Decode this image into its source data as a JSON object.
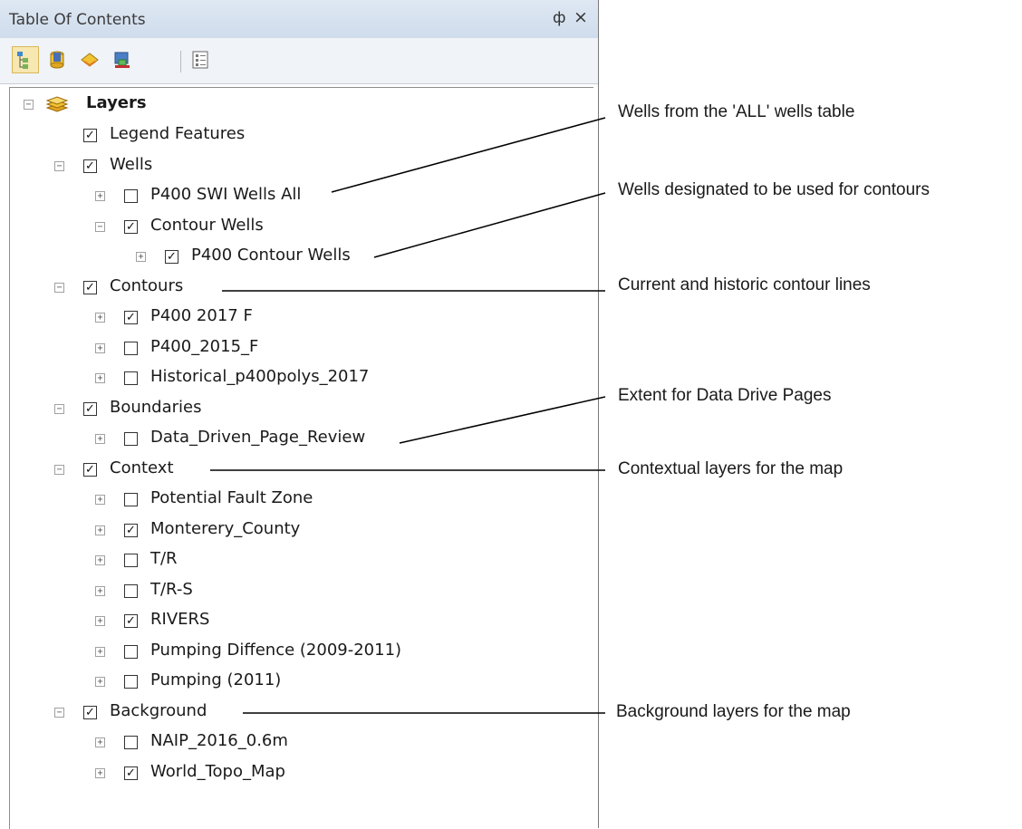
{
  "panel": {
    "title": "Table Of Contents",
    "pin_symbol": "ф",
    "close_symbol": "×",
    "toolbar": [
      {
        "name": "list-by-drawing-order-icon"
      },
      {
        "name": "list-by-source-icon"
      },
      {
        "name": "list-by-visibility-icon"
      },
      {
        "name": "list-by-selection-icon"
      },
      {
        "name": "options-icon"
      }
    ]
  },
  "tree": {
    "root": "Layers",
    "items": [
      {
        "label": "Legend Features",
        "checked": true,
        "expander": "",
        "indent": 0
      },
      {
        "label": "Wells",
        "checked": true,
        "expander": "minus",
        "indent": 0
      },
      {
        "label": "P400 SWI Wells All",
        "checked": false,
        "expander": "plus",
        "indent": 1
      },
      {
        "label": "Contour Wells",
        "checked": true,
        "expander": "minus",
        "indent": 1
      },
      {
        "label": "P400 Contour Wells",
        "checked": true,
        "expander": "plus",
        "indent": 2
      },
      {
        "label": "Contours",
        "checked": true,
        "expander": "minus",
        "indent": 0
      },
      {
        "label": "P400 2017 F",
        "checked": true,
        "expander": "plus",
        "indent": 1
      },
      {
        "label": "P400_2015_F",
        "checked": false,
        "expander": "plus",
        "indent": 1
      },
      {
        "label": "Historical_p400polys_2017",
        "checked": false,
        "expander": "plus",
        "indent": 1
      },
      {
        "label": "Boundaries",
        "checked": true,
        "expander": "minus",
        "indent": 0
      },
      {
        "label": "Data_Driven_Page_Review",
        "checked": false,
        "expander": "plus",
        "indent": 1
      },
      {
        "label": "Context",
        "checked": true,
        "expander": "minus",
        "indent": 0
      },
      {
        "label": "Potential Fault Zone",
        "checked": false,
        "expander": "plus",
        "indent": 1
      },
      {
        "label": "Monterery_County",
        "checked": true,
        "expander": "plus",
        "indent": 1
      },
      {
        "label": "T/R",
        "checked": false,
        "expander": "plus",
        "indent": 1
      },
      {
        "label": "T/R-S",
        "checked": false,
        "expander": "plus",
        "indent": 1
      },
      {
        "label": "RIVERS",
        "checked": true,
        "expander": "plus",
        "indent": 1
      },
      {
        "label": "Pumping Diffence (2009-2011)",
        "checked": false,
        "expander": "plus",
        "indent": 1
      },
      {
        "label": "Pumping (2011)",
        "checked": false,
        "expander": "plus",
        "indent": 1
      },
      {
        "label": "Background",
        "checked": true,
        "expander": "minus",
        "indent": 0
      },
      {
        "label": "NAIP_2016_0.6m",
        "checked": false,
        "expander": "plus",
        "indent": 1
      },
      {
        "label": "World_Topo_Map",
        "checked": true,
        "expander": "plus",
        "indent": 1
      }
    ]
  },
  "annotations": [
    {
      "text": "Wells from the 'ALL' wells table",
      "target_row": 2
    },
    {
      "text": "Wells designated to be used for contours",
      "target_row": 4
    },
    {
      "text": "Current and historic contour lines",
      "target_row": 5
    },
    {
      "text": "Extent for Data Drive Pages",
      "target_row": 10
    },
    {
      "text": "Contextual layers for the map",
      "target_row": 11
    },
    {
      "text": "Background layers for the map",
      "target_row": 19
    }
  ],
  "colors": {
    "check": "#111111",
    "layers_icon": "#e0a521"
  }
}
